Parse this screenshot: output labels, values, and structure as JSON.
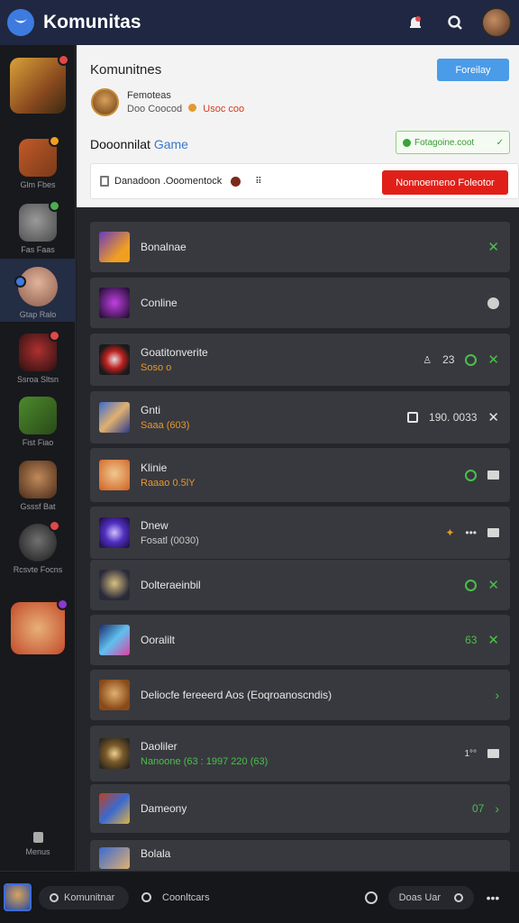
{
  "app": {
    "title": "Komunitas"
  },
  "rail": {
    "items": [
      {
        "label": ""
      },
      {
        "label": "Glm Fbes"
      },
      {
        "label": "Fas Faas"
      },
      {
        "label": "Gtap Ralo"
      },
      {
        "label": "Ssroa Sltsn"
      },
      {
        "label": "Fist Fiao"
      },
      {
        "label": "Gsssf Bat"
      },
      {
        "label": "Rcsvte Focns"
      },
      {
        "label": ""
      }
    ],
    "footer_label": "Menus"
  },
  "panel": {
    "title": "Komunitnes",
    "action_button": "Foreilay",
    "owner_name": "Femoteas",
    "owner_sub_prefix": "Doo Coocod",
    "owner_sub_highlight": "Usoc coo",
    "section_title_prefix": "Dooonnilat",
    "section_title_highlight": "Game",
    "status_text": "Fotagoine.coot",
    "invite_text": "Danadoon .Ooomentock",
    "red_button": "Nonnoemeno Foleotor"
  },
  "games": [
    {
      "name": "Bonalnae",
      "meta": "",
      "meta_color": "",
      "right_text": "",
      "icons": [
        "x-green"
      ]
    },
    {
      "name": "Conline",
      "meta": "",
      "meta_color": "",
      "right_text": "",
      "icons": [
        "circle-gray"
      ]
    },
    {
      "name": "Goatitonverite",
      "meta": "Soso o",
      "meta_color": "orange",
      "right_text": "23",
      "icons": [
        "circle-green",
        "x-green"
      ]
    },
    {
      "name": "Gnti",
      "meta": "Saaa (603)",
      "meta_color": "orange",
      "right_text": "190. 0033",
      "icons": [
        "x-white"
      ]
    },
    {
      "name": "Klinie",
      "meta": "Raaao 0.5lY",
      "meta_color": "orange",
      "right_text": "",
      "icons": [
        "circle-green",
        "mail"
      ]
    },
    {
      "name": "Dnew",
      "meta": "Fosatl (0030)",
      "meta_color": "gray",
      "right_text": "•••",
      "icons": [
        "mail"
      ]
    },
    {
      "name": "Dolteraeinbil",
      "meta": "",
      "meta_color": "",
      "right_text": "",
      "icons": [
        "circle-green",
        "x-green"
      ]
    },
    {
      "name": "Ooralilt",
      "meta": "",
      "meta_color": "",
      "right_text": "63",
      "icons": [
        "x-green"
      ]
    },
    {
      "name": "Deliocfe fereeerd Aos (Eoqroanoscndis)",
      "meta": "",
      "meta_color": "",
      "right_text": "",
      "icons": [
        "chev"
      ]
    },
    {
      "name": "Daoliler",
      "meta": "Nanoone (63 : 1997 220 (63)",
      "meta_color": "green",
      "right_text": "1°°",
      "icons": [
        "mail"
      ]
    },
    {
      "name": "Dameony",
      "meta": "",
      "meta_color": "",
      "right_text": "07",
      "icons": [
        "chev"
      ]
    },
    {
      "name": "Bolala",
      "meta": "",
      "meta_color": "",
      "right_text": "",
      "icons": []
    }
  ],
  "bottom": {
    "community_label": "Komunitnar",
    "center_label": "Coonltcars",
    "right_pill": "Doas Uar"
  }
}
